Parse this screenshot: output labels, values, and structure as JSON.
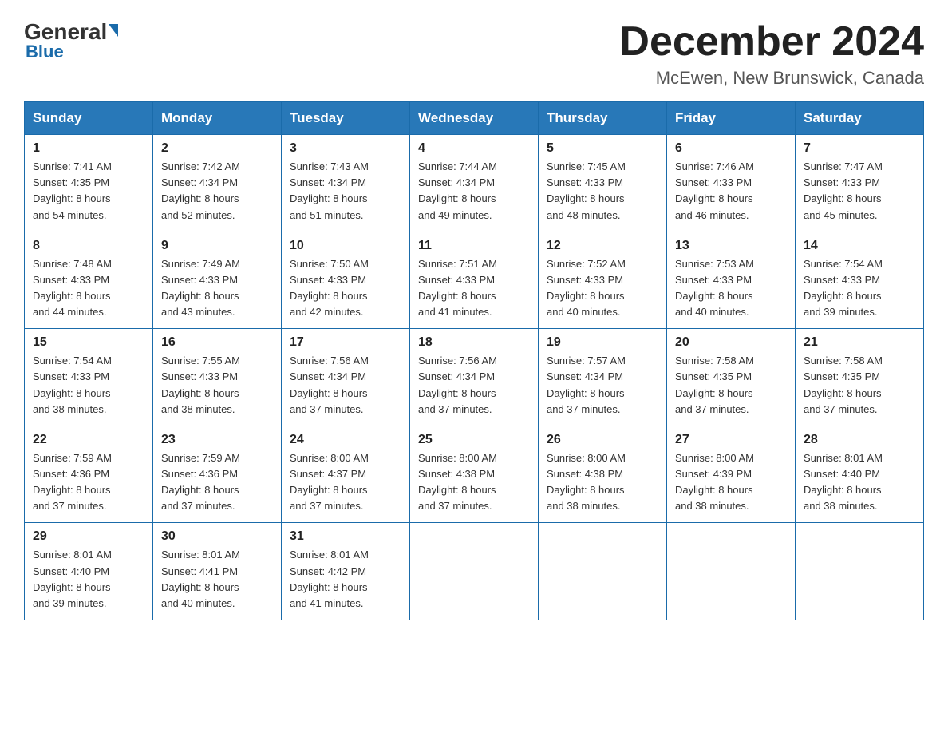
{
  "header": {
    "logo_general": "General",
    "logo_blue": "Blue",
    "month_title": "December 2024",
    "location": "McEwen, New Brunswick, Canada"
  },
  "weekdays": [
    "Sunday",
    "Monday",
    "Tuesday",
    "Wednesday",
    "Thursday",
    "Friday",
    "Saturday"
  ],
  "weeks": [
    [
      {
        "day": "1",
        "sunrise": "7:41 AM",
        "sunset": "4:35 PM",
        "daylight": "8 hours and 54 minutes."
      },
      {
        "day": "2",
        "sunrise": "7:42 AM",
        "sunset": "4:34 PM",
        "daylight": "8 hours and 52 minutes."
      },
      {
        "day": "3",
        "sunrise": "7:43 AM",
        "sunset": "4:34 PM",
        "daylight": "8 hours and 51 minutes."
      },
      {
        "day": "4",
        "sunrise": "7:44 AM",
        "sunset": "4:34 PM",
        "daylight": "8 hours and 49 minutes."
      },
      {
        "day": "5",
        "sunrise": "7:45 AM",
        "sunset": "4:33 PM",
        "daylight": "8 hours and 48 minutes."
      },
      {
        "day": "6",
        "sunrise": "7:46 AM",
        "sunset": "4:33 PM",
        "daylight": "8 hours and 46 minutes."
      },
      {
        "day": "7",
        "sunrise": "7:47 AM",
        "sunset": "4:33 PM",
        "daylight": "8 hours and 45 minutes."
      }
    ],
    [
      {
        "day": "8",
        "sunrise": "7:48 AM",
        "sunset": "4:33 PM",
        "daylight": "8 hours and 44 minutes."
      },
      {
        "day": "9",
        "sunrise": "7:49 AM",
        "sunset": "4:33 PM",
        "daylight": "8 hours and 43 minutes."
      },
      {
        "day": "10",
        "sunrise": "7:50 AM",
        "sunset": "4:33 PM",
        "daylight": "8 hours and 42 minutes."
      },
      {
        "day": "11",
        "sunrise": "7:51 AM",
        "sunset": "4:33 PM",
        "daylight": "8 hours and 41 minutes."
      },
      {
        "day": "12",
        "sunrise": "7:52 AM",
        "sunset": "4:33 PM",
        "daylight": "8 hours and 40 minutes."
      },
      {
        "day": "13",
        "sunrise": "7:53 AM",
        "sunset": "4:33 PM",
        "daylight": "8 hours and 40 minutes."
      },
      {
        "day": "14",
        "sunrise": "7:54 AM",
        "sunset": "4:33 PM",
        "daylight": "8 hours and 39 minutes."
      }
    ],
    [
      {
        "day": "15",
        "sunrise": "7:54 AM",
        "sunset": "4:33 PM",
        "daylight": "8 hours and 38 minutes."
      },
      {
        "day": "16",
        "sunrise": "7:55 AM",
        "sunset": "4:33 PM",
        "daylight": "8 hours and 38 minutes."
      },
      {
        "day": "17",
        "sunrise": "7:56 AM",
        "sunset": "4:34 PM",
        "daylight": "8 hours and 37 minutes."
      },
      {
        "day": "18",
        "sunrise": "7:56 AM",
        "sunset": "4:34 PM",
        "daylight": "8 hours and 37 minutes."
      },
      {
        "day": "19",
        "sunrise": "7:57 AM",
        "sunset": "4:34 PM",
        "daylight": "8 hours and 37 minutes."
      },
      {
        "day": "20",
        "sunrise": "7:58 AM",
        "sunset": "4:35 PM",
        "daylight": "8 hours and 37 minutes."
      },
      {
        "day": "21",
        "sunrise": "7:58 AM",
        "sunset": "4:35 PM",
        "daylight": "8 hours and 37 minutes."
      }
    ],
    [
      {
        "day": "22",
        "sunrise": "7:59 AM",
        "sunset": "4:36 PM",
        "daylight": "8 hours and 37 minutes."
      },
      {
        "day": "23",
        "sunrise": "7:59 AM",
        "sunset": "4:36 PM",
        "daylight": "8 hours and 37 minutes."
      },
      {
        "day": "24",
        "sunrise": "8:00 AM",
        "sunset": "4:37 PM",
        "daylight": "8 hours and 37 minutes."
      },
      {
        "day": "25",
        "sunrise": "8:00 AM",
        "sunset": "4:38 PM",
        "daylight": "8 hours and 37 minutes."
      },
      {
        "day": "26",
        "sunrise": "8:00 AM",
        "sunset": "4:38 PM",
        "daylight": "8 hours and 38 minutes."
      },
      {
        "day": "27",
        "sunrise": "8:00 AM",
        "sunset": "4:39 PM",
        "daylight": "8 hours and 38 minutes."
      },
      {
        "day": "28",
        "sunrise": "8:01 AM",
        "sunset": "4:40 PM",
        "daylight": "8 hours and 38 minutes."
      }
    ],
    [
      {
        "day": "29",
        "sunrise": "8:01 AM",
        "sunset": "4:40 PM",
        "daylight": "8 hours and 39 minutes."
      },
      {
        "day": "30",
        "sunrise": "8:01 AM",
        "sunset": "4:41 PM",
        "daylight": "8 hours and 40 minutes."
      },
      {
        "day": "31",
        "sunrise": "8:01 AM",
        "sunset": "4:42 PM",
        "daylight": "8 hours and 41 minutes."
      },
      null,
      null,
      null,
      null
    ]
  ],
  "labels": {
    "sunrise": "Sunrise:",
    "sunset": "Sunset:",
    "daylight": "Daylight:"
  }
}
